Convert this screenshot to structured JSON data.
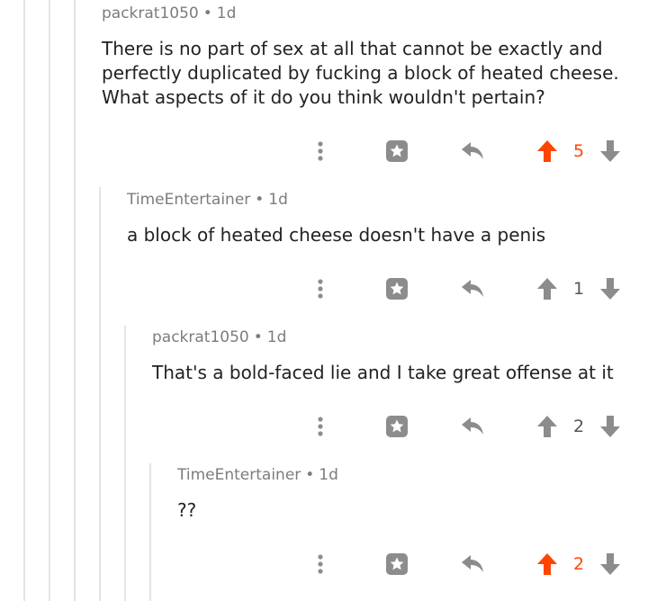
{
  "colors": {
    "upvoted": "#ff4500",
    "neutral": "#8c8c8c",
    "thread_line": "#e4e4e4",
    "meta_text": "#7c7c7c",
    "body_text": "#222222"
  },
  "comments": [
    {
      "author": "packrat1050",
      "separator": "•",
      "age": "1d",
      "body_lines": [
        "There is no part of sex at all that cannot be exactly and",
        "perfectly duplicated by fucking a block of heated cheese.",
        "What aspects of it do you think wouldn't pertain?"
      ],
      "score": "5",
      "upvoted": true,
      "icons": [
        "more-options-icon",
        "award-icon",
        "reply-icon",
        "upvote-icon",
        "downvote-icon"
      ]
    },
    {
      "author": "TimeEntertainer",
      "separator": "•",
      "age": "1d",
      "body_lines": [
        "a block of heated cheese doesn't have a penis"
      ],
      "score": "1",
      "upvoted": false,
      "icons": [
        "more-options-icon",
        "award-icon",
        "reply-icon",
        "upvote-icon",
        "downvote-icon"
      ]
    },
    {
      "author": "packrat1050",
      "separator": "•",
      "age": "1d",
      "body_lines": [
        "That's a bold-faced lie and I take great offense at it"
      ],
      "score": "2",
      "upvoted": false,
      "icons": [
        "more-options-icon",
        "award-icon",
        "reply-icon",
        "upvote-icon",
        "downvote-icon"
      ]
    },
    {
      "author": "TimeEntertainer",
      "separator": "•",
      "age": "1d",
      "body_lines": [
        "??"
      ],
      "score": "2",
      "upvoted": true,
      "icons": [
        "more-options-icon",
        "award-icon",
        "reply-icon",
        "upvote-icon",
        "downvote-icon"
      ]
    }
  ]
}
